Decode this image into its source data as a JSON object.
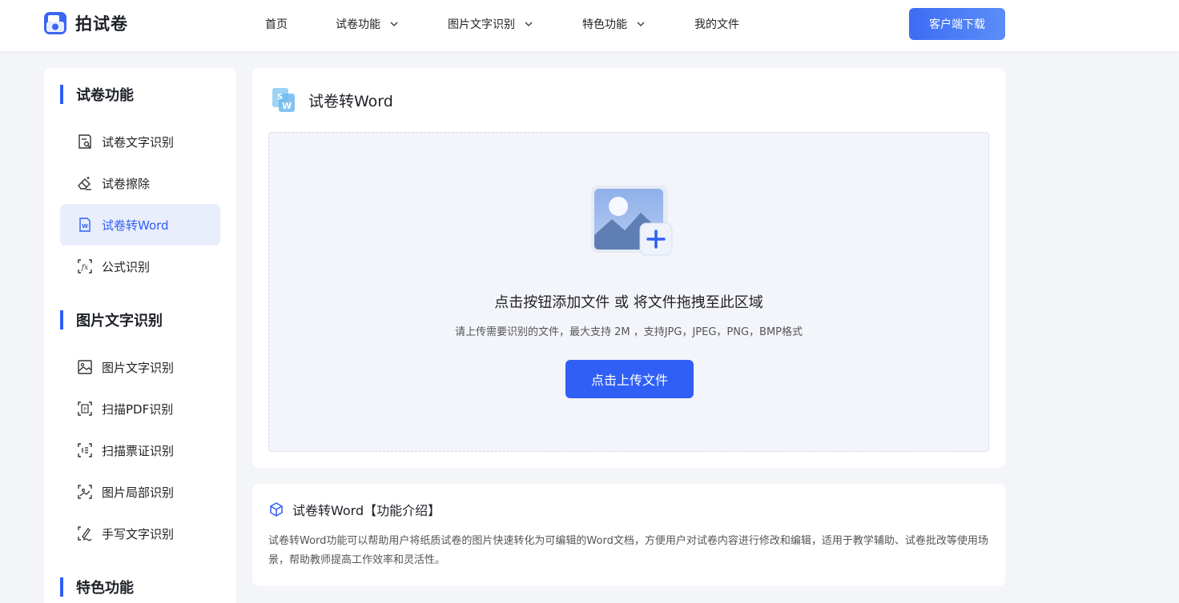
{
  "header": {
    "brand": "拍试卷",
    "nav": [
      {
        "label": "首页",
        "has_dropdown": false
      },
      {
        "label": "试卷功能",
        "has_dropdown": true
      },
      {
        "label": "图片文字识别",
        "has_dropdown": true
      },
      {
        "label": "特色功能",
        "has_dropdown": true
      },
      {
        "label": "我的文件",
        "has_dropdown": false
      }
    ],
    "download_label": "客户端下载"
  },
  "sidebar": {
    "sections": [
      {
        "title": "试卷功能",
        "items": [
          {
            "label": "试卷文字识别",
            "icon": "paper-scan-icon"
          },
          {
            "label": "试卷擦除",
            "icon": "eraser-icon"
          },
          {
            "label": "试卷转Word",
            "icon": "word-doc-icon",
            "active": true
          },
          {
            "label": "公式识别",
            "icon": "formula-icon"
          }
        ]
      },
      {
        "title": "图片文字识别",
        "items": [
          {
            "label": "图片文字识别",
            "icon": "image-icon"
          },
          {
            "label": "扫描PDF识别",
            "icon": "pdf-scan-icon"
          },
          {
            "label": "扫描票证识别",
            "icon": "ticket-scan-icon"
          },
          {
            "label": "图片局部识别",
            "icon": "image-crop-icon"
          },
          {
            "label": "手写文字识别",
            "icon": "handwriting-icon"
          }
        ]
      },
      {
        "title": "特色功能",
        "items": []
      }
    ]
  },
  "main": {
    "title": "试卷转Word",
    "drop_main": "点击按钮添加文件 或 将文件拖拽至此区域",
    "drop_sub": "请上传需要识别的文件，最大支持 2M ，支持JPG，JPEG，PNG，BMP格式",
    "upload_label": "点击上传文件"
  },
  "intro": {
    "title": "试卷转Word【功能介绍】",
    "text": "试卷转Word功能可以帮助用户将纸质试卷的图片快速转化为可编辑的Word文档，方便用户对试卷内容进行修改和编辑，适用于教学辅助、试卷批改等使用场景，帮助教师提高工作效率和灵活性。"
  },
  "colors": {
    "accent": "#2f5ff5",
    "active_bg": "#e9eefd",
    "page_bg": "#f4f5f8"
  }
}
